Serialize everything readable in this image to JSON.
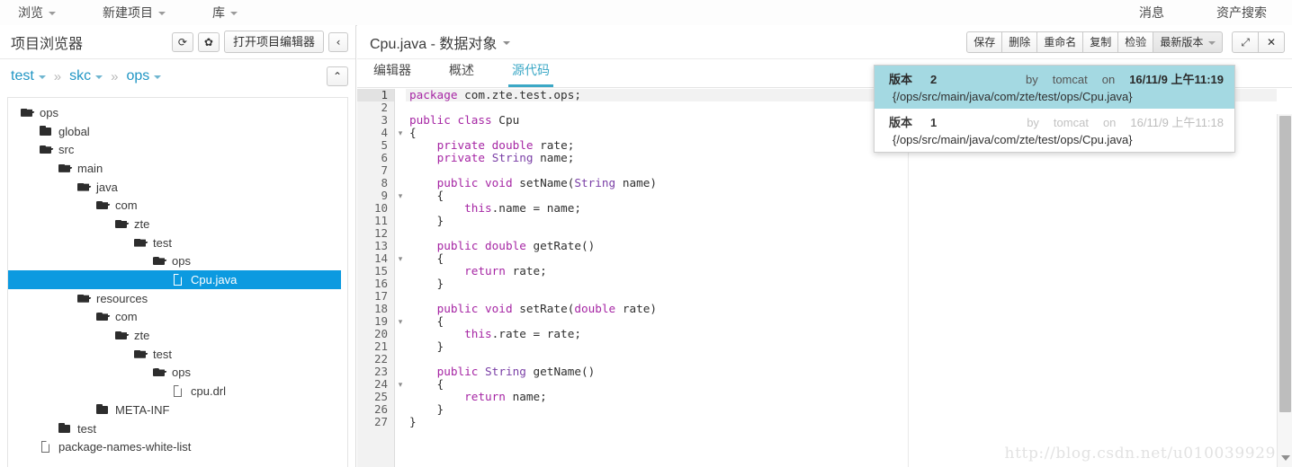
{
  "topbar": {
    "menus": [
      {
        "label": "浏览",
        "icon": "chevron-down-icon"
      },
      {
        "label": "新建项目",
        "icon": "chevron-down-icon"
      },
      {
        "label": "库",
        "icon": "chevron-down-icon"
      }
    ],
    "right": [
      {
        "label": "消息"
      },
      {
        "label": "资产搜索"
      }
    ]
  },
  "left_panel": {
    "title": "项目浏览器",
    "buttons": {
      "refresh": "⟳",
      "settings": "✿",
      "open_editor": "打开项目编辑器",
      "collapse": "‹"
    },
    "breadcrumb": {
      "items": [
        "test",
        "skc",
        "ops"
      ],
      "separator": "»",
      "collapse_button": "⌃"
    },
    "tree": [
      {
        "label": "ops",
        "icon": "folder-open-icon",
        "depth": 0,
        "selected": false
      },
      {
        "label": "global",
        "icon": "folder-icon",
        "depth": 1,
        "selected": false
      },
      {
        "label": "src",
        "icon": "folder-open-icon",
        "depth": 1,
        "selected": false
      },
      {
        "label": "main",
        "icon": "folder-open-icon",
        "depth": 2,
        "selected": false
      },
      {
        "label": "java",
        "icon": "folder-open-icon",
        "depth": 3,
        "selected": false
      },
      {
        "label": "com",
        "icon": "folder-open-icon",
        "depth": 4,
        "selected": false
      },
      {
        "label": "zte",
        "icon": "folder-open-icon",
        "depth": 5,
        "selected": false
      },
      {
        "label": "test",
        "icon": "folder-open-icon",
        "depth": 6,
        "selected": false
      },
      {
        "label": "ops",
        "icon": "folder-open-icon",
        "depth": 7,
        "selected": false
      },
      {
        "label": "Cpu.java",
        "icon": "file-icon",
        "depth": 8,
        "selected": true
      },
      {
        "label": "resources",
        "icon": "folder-open-icon",
        "depth": 3,
        "selected": false
      },
      {
        "label": "com",
        "icon": "folder-open-icon",
        "depth": 4,
        "selected": false
      },
      {
        "label": "zte",
        "icon": "folder-open-icon",
        "depth": 5,
        "selected": false
      },
      {
        "label": "test",
        "icon": "folder-open-icon",
        "depth": 6,
        "selected": false
      },
      {
        "label": "ops",
        "icon": "folder-open-icon",
        "depth": 7,
        "selected": false
      },
      {
        "label": "cpu.drl",
        "icon": "file-icon",
        "depth": 8,
        "selected": false
      },
      {
        "label": "META-INF",
        "icon": "folder-icon",
        "depth": 4,
        "selected": false
      },
      {
        "label": "test",
        "icon": "folder-icon",
        "depth": 2,
        "selected": false
      },
      {
        "label": "package-names-white-list",
        "icon": "file-icon",
        "depth": 1,
        "selected": false
      }
    ]
  },
  "main": {
    "doc_title": "Cpu.java - 数据对象",
    "toolbar": {
      "save": "保存",
      "delete": "删除",
      "rename": "重命名",
      "copy": "复制",
      "validate": "检验",
      "version": "最新版本",
      "expand": "⤢",
      "close": "✕"
    },
    "tabs": [
      {
        "label": "编辑器",
        "active": false
      },
      {
        "label": "概述",
        "active": false
      },
      {
        "label": "源代码",
        "active": true
      }
    ],
    "accent_color": "#3ba8c6"
  },
  "version_menu": {
    "rows": [
      {
        "label": "版本",
        "number": "2",
        "by": "by",
        "author": "tomcat",
        "on": "on",
        "date": "16/11/9 上午11:19",
        "path": "{/ops/src/main/java/com/zte/test/ops/Cpu.java}",
        "selected": true
      },
      {
        "label": "版本",
        "number": "1",
        "by": "by",
        "author": "tomcat",
        "on": "on",
        "date": "16/11/9 上午11:18",
        "path": "{/ops/src/main/java/com/zte/test/ops/Cpu.java}",
        "selected": false
      }
    ],
    "highlight_color": "#a4d9e2"
  },
  "code": {
    "lines": [
      {
        "n": "1",
        "fold": "",
        "current": true,
        "tokens": [
          {
            "t": "package",
            "c": "kw"
          },
          {
            "t": " com.zte.test.ops;",
            "c": ""
          }
        ]
      },
      {
        "n": "2",
        "fold": "",
        "current": false,
        "tokens": []
      },
      {
        "n": "3",
        "fold": "",
        "current": false,
        "tokens": [
          {
            "t": "public class",
            "c": "kw"
          },
          {
            "t": " Cpu",
            "c": ""
          }
        ]
      },
      {
        "n": "4",
        "fold": "▾",
        "current": false,
        "tokens": [
          {
            "t": "{",
            "c": ""
          }
        ]
      },
      {
        "n": "5",
        "fold": "",
        "current": false,
        "tokens": [
          {
            "t": "    ",
            "c": ""
          },
          {
            "t": "private double",
            "c": "kw"
          },
          {
            "t": " rate;",
            "c": ""
          }
        ]
      },
      {
        "n": "6",
        "fold": "",
        "current": false,
        "tokens": [
          {
            "t": "    ",
            "c": ""
          },
          {
            "t": "private",
            "c": "kw"
          },
          {
            "t": " ",
            "c": ""
          },
          {
            "t": "String",
            "c": "ty"
          },
          {
            "t": " name;",
            "c": ""
          }
        ]
      },
      {
        "n": "7",
        "fold": "",
        "current": false,
        "tokens": []
      },
      {
        "n": "8",
        "fold": "",
        "current": false,
        "tokens": [
          {
            "t": "    ",
            "c": ""
          },
          {
            "t": "public void",
            "c": "kw"
          },
          {
            "t": " setName(",
            "c": ""
          },
          {
            "t": "String",
            "c": "ty"
          },
          {
            "t": " name)",
            "c": ""
          }
        ]
      },
      {
        "n": "9",
        "fold": "▾",
        "current": false,
        "tokens": [
          {
            "t": "    {",
            "c": ""
          }
        ]
      },
      {
        "n": "10",
        "fold": "",
        "current": false,
        "tokens": [
          {
            "t": "        ",
            "c": ""
          },
          {
            "t": "this",
            "c": "kw"
          },
          {
            "t": ".name = name;",
            "c": ""
          }
        ]
      },
      {
        "n": "11",
        "fold": "",
        "current": false,
        "tokens": [
          {
            "t": "    }",
            "c": ""
          }
        ]
      },
      {
        "n": "12",
        "fold": "",
        "current": false,
        "tokens": []
      },
      {
        "n": "13",
        "fold": "",
        "current": false,
        "tokens": [
          {
            "t": "    ",
            "c": ""
          },
          {
            "t": "public double",
            "c": "kw"
          },
          {
            "t": " getRate()",
            "c": ""
          }
        ]
      },
      {
        "n": "14",
        "fold": "▾",
        "current": false,
        "tokens": [
          {
            "t": "    {",
            "c": ""
          }
        ]
      },
      {
        "n": "15",
        "fold": "",
        "current": false,
        "tokens": [
          {
            "t": "        ",
            "c": ""
          },
          {
            "t": "return",
            "c": "kw"
          },
          {
            "t": " rate;",
            "c": ""
          }
        ]
      },
      {
        "n": "16",
        "fold": "",
        "current": false,
        "tokens": [
          {
            "t": "    }",
            "c": ""
          }
        ]
      },
      {
        "n": "17",
        "fold": "",
        "current": false,
        "tokens": []
      },
      {
        "n": "18",
        "fold": "",
        "current": false,
        "tokens": [
          {
            "t": "    ",
            "c": ""
          },
          {
            "t": "public void",
            "c": "kw"
          },
          {
            "t": " setRate(",
            "c": ""
          },
          {
            "t": "double",
            "c": "kw"
          },
          {
            "t": " rate)",
            "c": ""
          }
        ]
      },
      {
        "n": "19",
        "fold": "▾",
        "current": false,
        "tokens": [
          {
            "t": "    {",
            "c": ""
          }
        ]
      },
      {
        "n": "20",
        "fold": "",
        "current": false,
        "tokens": [
          {
            "t": "        ",
            "c": ""
          },
          {
            "t": "this",
            "c": "kw"
          },
          {
            "t": ".rate = rate;",
            "c": ""
          }
        ]
      },
      {
        "n": "21",
        "fold": "",
        "current": false,
        "tokens": [
          {
            "t": "    }",
            "c": ""
          }
        ]
      },
      {
        "n": "22",
        "fold": "",
        "current": false,
        "tokens": []
      },
      {
        "n": "23",
        "fold": "",
        "current": false,
        "tokens": [
          {
            "t": "    ",
            "c": ""
          },
          {
            "t": "public",
            "c": "kw"
          },
          {
            "t": " ",
            "c": ""
          },
          {
            "t": "String",
            "c": "ty"
          },
          {
            "t": " getName()",
            "c": ""
          }
        ]
      },
      {
        "n": "24",
        "fold": "▾",
        "current": false,
        "tokens": [
          {
            "t": "    {",
            "c": ""
          }
        ]
      },
      {
        "n": "25",
        "fold": "",
        "current": false,
        "tokens": [
          {
            "t": "        ",
            "c": ""
          },
          {
            "t": "return",
            "c": "kw"
          },
          {
            "t": " name;",
            "c": ""
          }
        ]
      },
      {
        "n": "26",
        "fold": "",
        "current": false,
        "tokens": [
          {
            "t": "    }",
            "c": ""
          }
        ]
      },
      {
        "n": "27",
        "fold": "",
        "current": false,
        "tokens": [
          {
            "t": "}",
            "c": ""
          }
        ]
      }
    ]
  },
  "watermark": "http://blog.csdn.net/u010039929"
}
